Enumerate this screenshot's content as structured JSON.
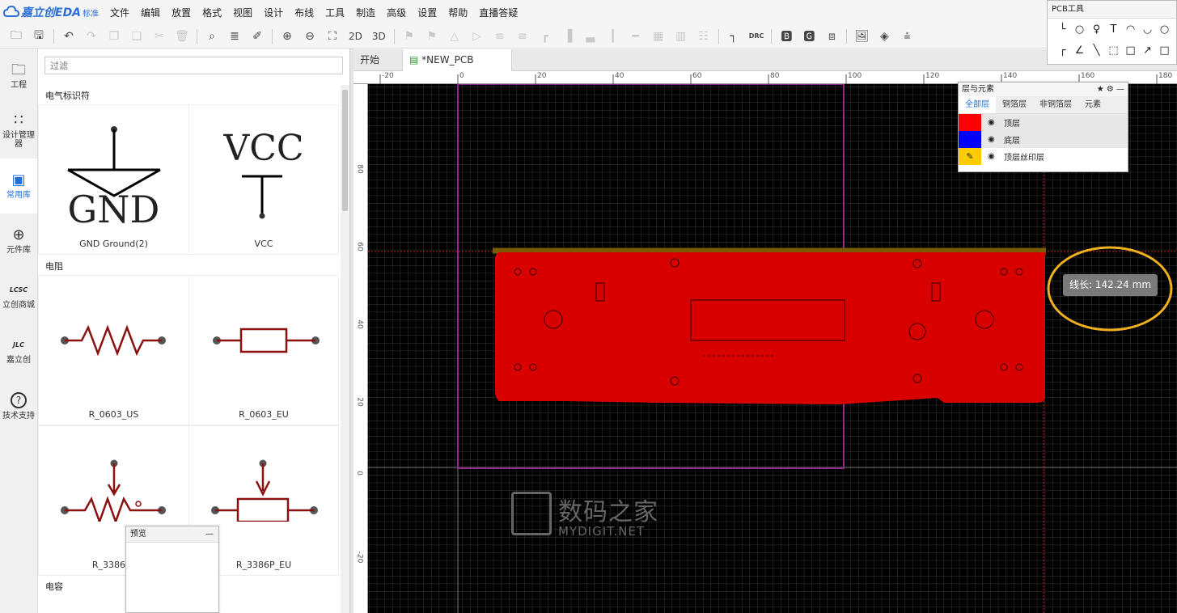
{
  "brand": {
    "name": "嘉立创EDA",
    "edition": "标准"
  },
  "menu": [
    "文件",
    "编辑",
    "放置",
    "格式",
    "视图",
    "设计",
    "布线",
    "工具",
    "制造",
    "高级",
    "设置",
    "帮助",
    "直播答疑"
  ],
  "toolbar": {
    "view_2d": "2D",
    "view_3d": "3D",
    "drc": "DRC"
  },
  "leftnav": [
    {
      "label": "工程",
      "icon": "folder-icon"
    },
    {
      "label": "设计管理器",
      "icon": "tree-icon"
    },
    {
      "label": "常用库",
      "icon": "chip-icon",
      "active": true
    },
    {
      "label": "元件库",
      "icon": "search-part-icon"
    },
    {
      "label": "立创商城",
      "icon": "lcsc-icon",
      "badge": "LCSC"
    },
    {
      "label": "嘉立创",
      "icon": "jlc-icon",
      "badge": "JLC"
    },
    {
      "label": "技术支持",
      "icon": "help-icon",
      "badge": "?"
    }
  ],
  "library": {
    "filter_placeholder": "过滤",
    "section_power": "电气标识符",
    "section_resistor": "电阻",
    "section_capacitor": "电容",
    "items": [
      "GND Ground(2)",
      "VCC",
      "R_0603_US",
      "R_0603_EU",
      "R_3386P_",
      "R_3386P_EU"
    ],
    "symbol_gnd": "GND",
    "symbol_vcc": "VCC"
  },
  "preview": {
    "title": "预览",
    "minimize": "—"
  },
  "tabs": [
    {
      "label": "开始"
    },
    {
      "label": "*NEW_PCB",
      "active": true
    }
  ],
  "ruler_top": [
    "-20",
    "0",
    "20",
    "40",
    "60",
    "80",
    "100",
    "120",
    "140",
    "160",
    "180"
  ],
  "ruler_left": [
    "80",
    "60",
    "40",
    "20",
    "0",
    "-20"
  ],
  "layers_panel": {
    "title": "层与元素",
    "tabs": [
      "全部层",
      "铜箔层",
      "非铜箔层",
      "元素"
    ],
    "rows": [
      {
        "name": "顶层",
        "color": "#ff0000"
      },
      {
        "name": "底层",
        "color": "#0000ff"
      },
      {
        "name": "顶层丝印层",
        "color": "#ffcc00"
      }
    ]
  },
  "pcb_tools": {
    "title": "PCB工具"
  },
  "measure_tooltip": "线长: 142.24 mm",
  "watermark": {
    "cn": "数码之家",
    "en": "MYDIGIT.NET"
  },
  "colors": {
    "copper_top": "#d90000",
    "board_outline": "#8a2a8a",
    "highlight_circle": "#f0b020",
    "grid": "#3a3a3a"
  }
}
